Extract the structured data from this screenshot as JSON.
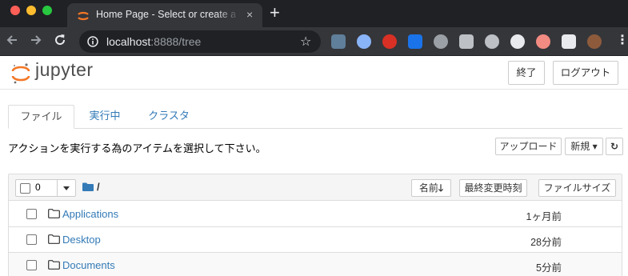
{
  "browser": {
    "tab_title": "Home Page - Select or create a notebook",
    "tab_close": "×",
    "new_tab": "+",
    "url_host": "localhost",
    "url_rest": ":8888/tree",
    "icons": [
      "back-arrow-icon",
      "forward-arrow-icon",
      "reload-icon",
      "info-icon",
      "star-icon",
      "menu-dots-icon"
    ],
    "extension_colors": [
      "#5f7f9a",
      "#8ab4f8",
      "#d93025",
      "#1a73e8",
      "#9aa0a6",
      "#bdc1c6",
      "#bdc1c6",
      "#e8eaed",
      "#f28b82",
      "#e8eaed",
      "#8d5b3c"
    ]
  },
  "header": {
    "logo_text": "jupyter",
    "quit_label": "終了",
    "logout_label": "ログアウト"
  },
  "tabs": [
    {
      "label": "ファイル"
    },
    {
      "label": "実行中"
    },
    {
      "label": "クラスタ"
    }
  ],
  "actions": {
    "instructions": "アクションを実行する為のアイテムを選択して下さい。",
    "upload_label": "アップロード",
    "new_label": "新規",
    "new_caret": "▾",
    "refresh_icon": "↻"
  },
  "list": {
    "selected_count": "0",
    "breadcrumb": "/",
    "sort_name_label": "名前",
    "sort_name_arrow": "🡓",
    "sort_modified_label": "最終変更時刻",
    "sort_size_label": "ファイルサイズ",
    "rows": [
      {
        "name": "Applications",
        "modified": "1ヶ月前"
      },
      {
        "name": "Desktop",
        "modified": "28分前"
      },
      {
        "name": "Documents",
        "modified": "5分前"
      }
    ]
  },
  "colors": {
    "chrome_dark": "#202124",
    "chrome_toolbar": "#35363a",
    "link_blue": "#337ab7",
    "jupyter_orange": "#f37726"
  }
}
